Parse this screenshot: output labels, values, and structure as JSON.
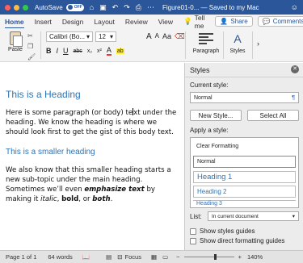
{
  "titlebar": {
    "autosave_label": "AutoSave",
    "autosave_state": "OFF",
    "doc_title": "Figure01-0... — Saved to my Mac",
    "icons": [
      "home-icon",
      "save-icon",
      "undo-icon",
      "redo-icon",
      "print-icon",
      "more-icon",
      "smiley-icon"
    ],
    "accent": "#2b579a"
  },
  "tabs": {
    "items": [
      "Home",
      "Insert",
      "Design",
      "Layout",
      "Review",
      "View"
    ],
    "active": "Home",
    "tell_me": "Tell me",
    "share_label": "Share",
    "comments_label": "Comments"
  },
  "ribbon": {
    "paste_label": "Paste",
    "font_name": "Calibri (Bo...",
    "font_size": "12",
    "bold": "B",
    "italic": "I",
    "underline": "U",
    "strike": "abc",
    "subscript": "x₂",
    "superscript": "x²",
    "grow": "A",
    "shrink": "A",
    "case": "Aa",
    "font_color": "A",
    "highlight": "ab",
    "paragraph_label": "Paragraph",
    "styles_label": "Styles"
  },
  "document": {
    "heading1": "This is a Heading",
    "paragraph1_before_cursor": "Here is some paragraph (or body) te",
    "paragraph1_after_cursor": "xt under the heading. We know the heading is where we should look first to get the gist of this body text.",
    "heading2": "This is a smaller heading",
    "paragraph2_part1": "We also know that this smaller heading starts a new sub-topic under the main heading. Sometimes we’ll even ",
    "paragraph2_emph": "emphasize text",
    "paragraph2_part2": " by making it ",
    "paragraph2_italic": "italic",
    "paragraph2_comma": ", ",
    "paragraph2_bold": "bold",
    "paragraph2_or": ", or ",
    "paragraph2_both": "both",
    "paragraph2_end": "."
  },
  "styles_pane": {
    "title": "Styles",
    "current_style_label": "Current style:",
    "current_style": "Normal",
    "para_mark": "¶",
    "new_style": "New Style...",
    "select_all": "Select All",
    "apply_label": "Apply a style:",
    "styles": [
      "Clear Formatting",
      "Normal",
      "Heading 1",
      "Heading 2",
      "Heading 3"
    ],
    "list_label": "List:",
    "list_value": "In current document",
    "show_guides": "Show styles guides",
    "show_direct": "Show direct formatting guides"
  },
  "statusbar": {
    "page": "Page 1 of 1",
    "words": "64 words",
    "focus": "Focus",
    "zoom": "140%",
    "zoom_fraction": 0.63
  }
}
